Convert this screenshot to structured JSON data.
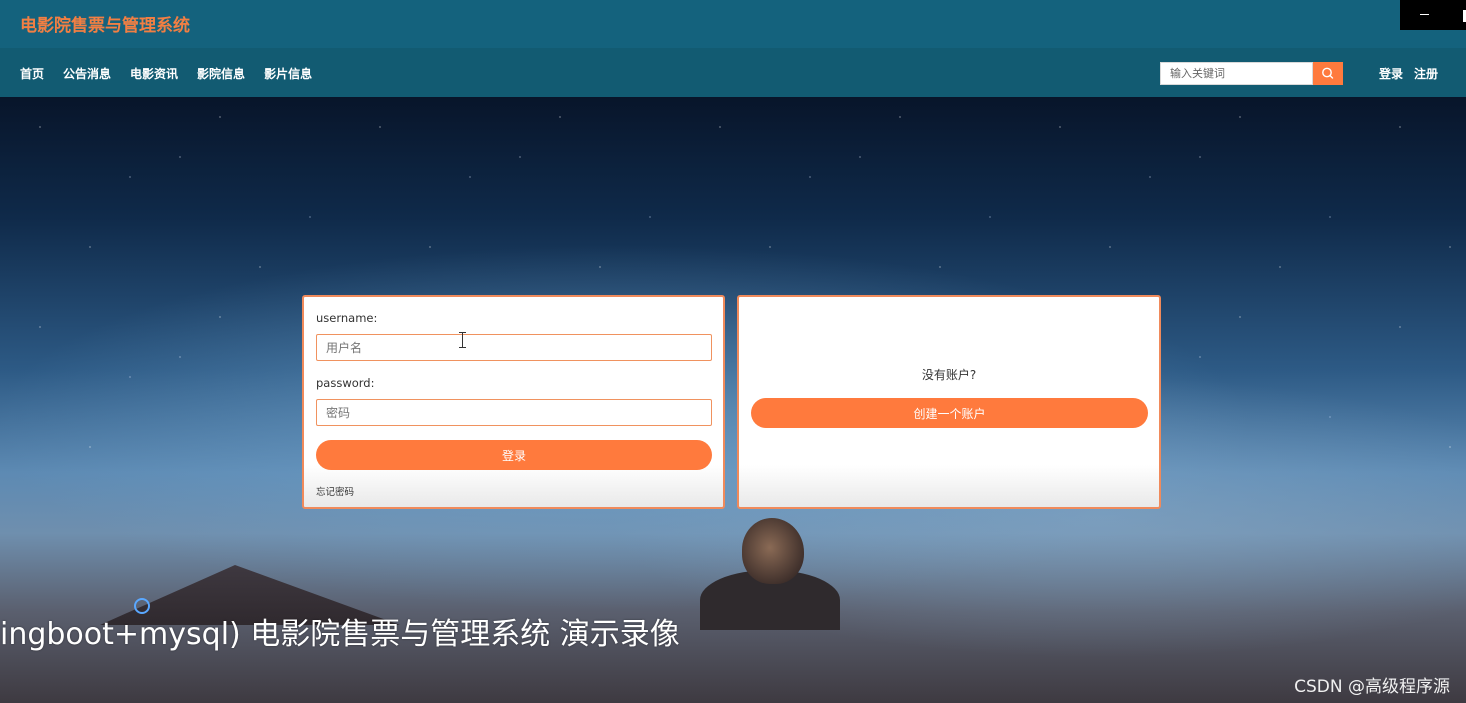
{
  "site": {
    "title": "电影院售票与管理系统"
  },
  "nav": {
    "items": [
      "首页",
      "公告消息",
      "电影资讯",
      "影院信息",
      "影片信息"
    ]
  },
  "search": {
    "placeholder": "输入关键词",
    "icon": "search-icon"
  },
  "auth": {
    "login": "登录",
    "register": "注册"
  },
  "login_form": {
    "username_label": "username:",
    "username_placeholder": "用户名",
    "password_label": "password:",
    "password_placeholder": "密码",
    "submit_label": "登录",
    "forgot_label": "忘记密码"
  },
  "register_panel": {
    "prompt": "没有账户?",
    "create_label": "创建一个账户"
  },
  "overlay": {
    "caption": "ingboot+mysql) 电影院售票与管理系统 演示录像",
    "watermark": "CSDN @高级程序源"
  },
  "colors": {
    "header_bg": "#14627d",
    "nav_bg": "#125b72",
    "accent": "#ff7a3d",
    "title_color": "#f27f43"
  }
}
